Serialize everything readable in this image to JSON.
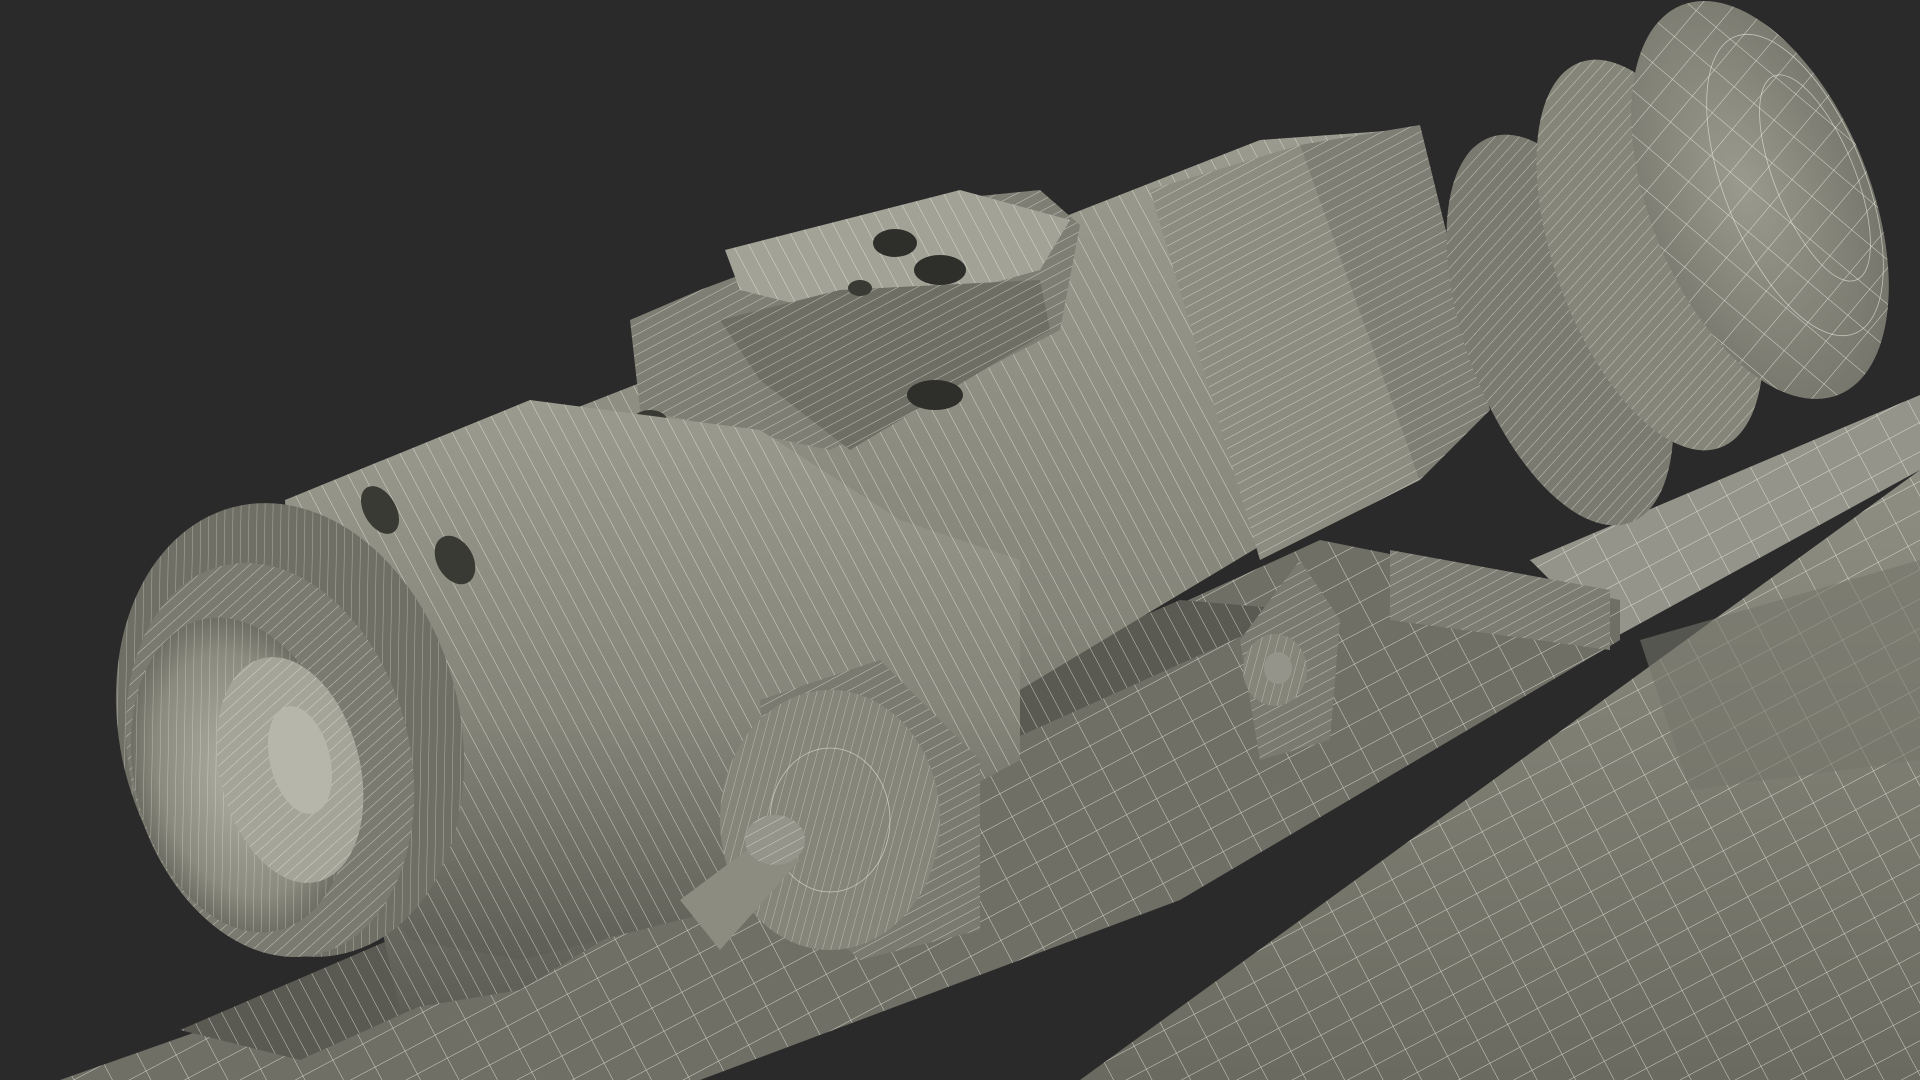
{
  "scene": {
    "kind": "3d-wireframe-render",
    "subject": "rifle-scope-with-night-vision-clip-on",
    "background_color": "#2a2a2a",
    "surface_color": "#8a8a7e",
    "surface_shadow_color": "#6b6b62",
    "surface_highlight_color": "#9c9c90",
    "wire_color": "#f0f0e6"
  }
}
